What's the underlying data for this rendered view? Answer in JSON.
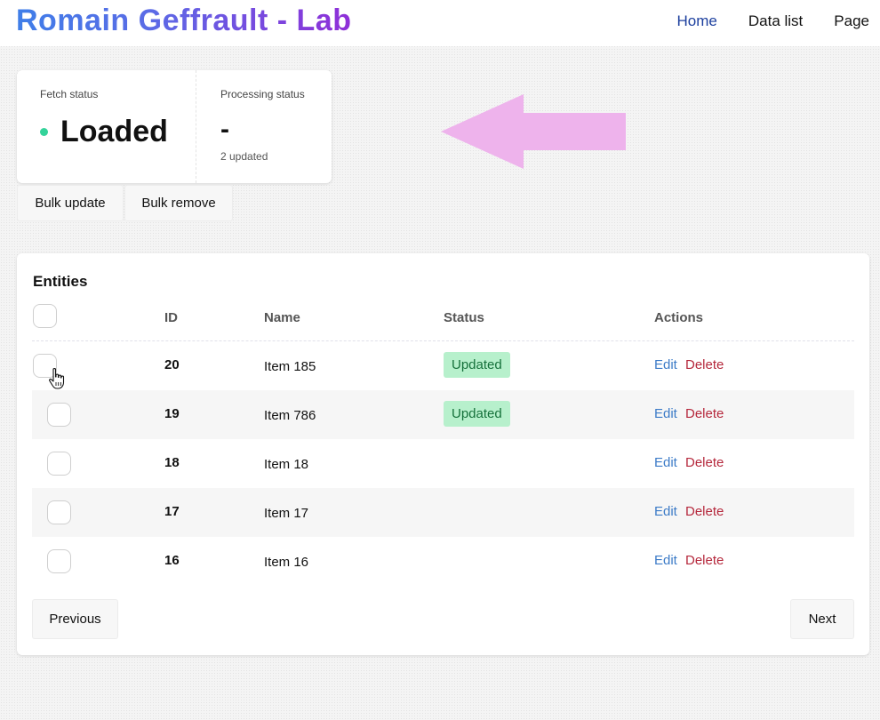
{
  "header": {
    "brand": "Romain Geffrault - Lab",
    "nav": [
      {
        "label": "Home",
        "active": true
      },
      {
        "label": "Data list",
        "active": false
      },
      {
        "label": "Page",
        "active": false
      }
    ]
  },
  "status": {
    "fetch_label": "Fetch status",
    "fetch_value": "Loaded",
    "fetch_dot_color": "#34d39a",
    "processing_label": "Processing status",
    "processing_value": "-",
    "processing_sub": "2 updated"
  },
  "bulk": {
    "update_label": "Bulk update",
    "remove_label": "Bulk remove"
  },
  "entities": {
    "title": "Entities",
    "columns": {
      "id": "ID",
      "name": "Name",
      "status": "Status",
      "actions": "Actions"
    },
    "rows": [
      {
        "id": "20",
        "name": "Item 185",
        "status": "Updated",
        "edit": "Edit",
        "delete": "Delete"
      },
      {
        "id": "19",
        "name": "Item 786",
        "status": "Updated",
        "edit": "Edit",
        "delete": "Delete"
      },
      {
        "id": "18",
        "name": "Item 18",
        "status": "",
        "edit": "Edit",
        "delete": "Delete"
      },
      {
        "id": "17",
        "name": "Item 17",
        "status": "",
        "edit": "Edit",
        "delete": "Delete"
      },
      {
        "id": "16",
        "name": "Item 16",
        "status": "",
        "edit": "Edit",
        "delete": "Delete"
      }
    ],
    "previous_label": "Previous",
    "next_label": "Next"
  },
  "colors": {
    "brand_gradient_start": "#3f7ee8",
    "brand_gradient_end": "#8f2fd8",
    "badge_bg": "#b7f0cc",
    "badge_text": "#16713b",
    "edit": "#3c7bc7",
    "delete": "#b5283c",
    "arrow": "#eeb3ec"
  },
  "icons": {
    "status_dot": "green-dot",
    "arrow": "left-arrow",
    "cursor": "hand-pointer"
  }
}
